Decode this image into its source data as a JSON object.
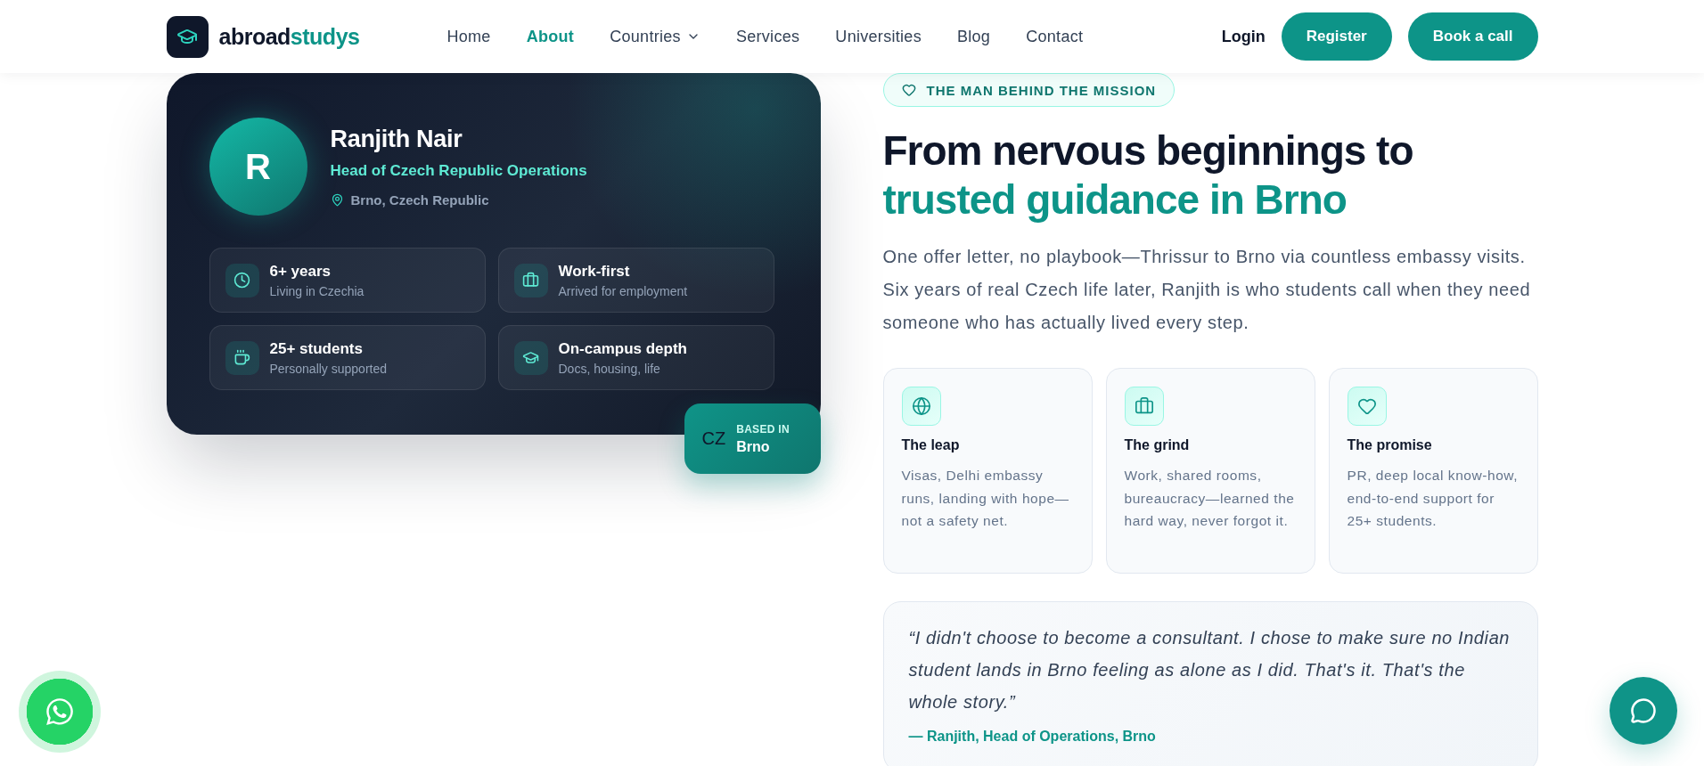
{
  "header": {
    "logo": {
      "dark_part": "abroad",
      "accent_part": "studys"
    },
    "nav": [
      {
        "label": "Home",
        "selected": false,
        "kind": "link"
      },
      {
        "label": "About",
        "selected": true,
        "kind": "link"
      },
      {
        "label": "Countries",
        "selected": false,
        "kind": "dropdown"
      },
      {
        "label": "Services",
        "selected": false,
        "kind": "link"
      },
      {
        "label": "Universities",
        "selected": false,
        "kind": "link"
      },
      {
        "label": "Blog",
        "selected": false,
        "kind": "link"
      },
      {
        "label": "Contact",
        "selected": false,
        "kind": "link"
      }
    ],
    "actions": [
      {
        "label": "Login",
        "kind": "link"
      },
      {
        "label": "Register",
        "kind": "button"
      },
      {
        "label": "Book a call",
        "kind": "button"
      }
    ]
  },
  "profile": {
    "initial": "R",
    "name": "Ranjith Nair",
    "role": "Head of Czech Republic Operations",
    "location": "Brno, Czech Republic",
    "stats": [
      {
        "value": "6+ years",
        "caption": "Living in Czechia"
      },
      {
        "value": "Work-first",
        "caption": "Arrived for employment"
      },
      {
        "value": "25+ students",
        "caption": "Personally supported"
      },
      {
        "value": "On-campus depth",
        "caption": "Docs, housing, life"
      }
    ],
    "based": {
      "code": "CZ",
      "label": "BASED IN",
      "city": "Brno"
    }
  },
  "story": {
    "eyebrow": "THE MAN BEHIND THE MISSION",
    "heading": "From nervous beginnings to",
    "heading_highlight": "trusted guidance in Brno",
    "intro": "One offer letter, no playbook—Thrissur to Brno via countless embassy visits. Six years of real Czech life later, Ranjith is who students call when they need someone who has actually lived every step.",
    "features": [
      {
        "title": "The leap",
        "text": "Visas, Delhi embassy runs, landing with hope—not a safety net."
      },
      {
        "title": "The grind",
        "text": "Work, shared rooms, bureaucracy—learned the hard way, never forgot it."
      },
      {
        "title": "The promise",
        "text": "PR, deep local know-how, end-to-end support for 25+ students."
      }
    ],
    "quote": {
      "text": "“I didn't choose to become a consultant. I chose to make sure no Indian student lands in Brno feeling as alone as I did. That's it. That's the whole story.”",
      "attribution": "— Ranjith, Head of Operations, Brno"
    }
  }
}
